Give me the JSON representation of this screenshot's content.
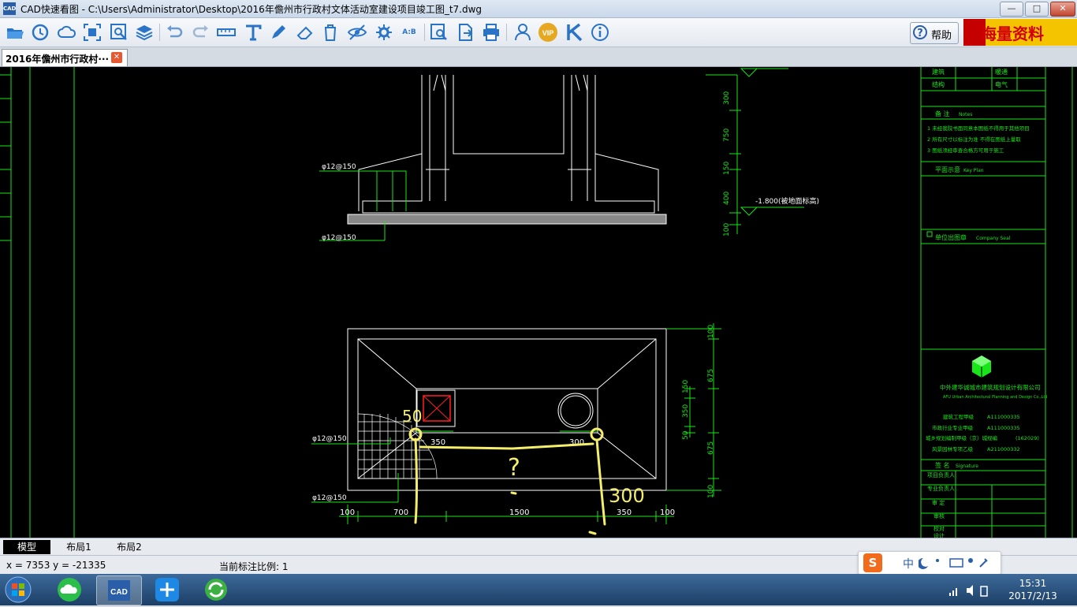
{
  "window": {
    "app_icon_text": "CAD",
    "title": "CAD快速看图 - C:\\Users\\Administrator\\Desktop\\2016年儋州市行政村文体活动室建设项目竣工图_t7.dwg",
    "controls": {
      "minimize": "—",
      "maximize": "□",
      "close": "✕"
    }
  },
  "toolbar": {
    "tools": [
      "open-folder-icon",
      "history-icon",
      "cloud-icon",
      "fit-extents-icon",
      "zoom-window-icon",
      "layers-icon",
      "undo-icon",
      "redo-icon",
      "measure-icon",
      "text-icon",
      "pen-icon",
      "eraser-icon",
      "delete-icon",
      "hide-icon",
      "settings-icon",
      "ab-dimension-icon",
      "find-text-icon",
      "export-icon",
      "print-icon",
      "user-icon",
      "vip-icon",
      "k-icon",
      "info-icon"
    ],
    "vip_label": "VIP",
    "ab_label": "A:B",
    "help_label": "帮助",
    "banner_text": "海量资料"
  },
  "doc_tab": {
    "label": "2016年儋州市行政村···",
    "close": "✕"
  },
  "drawing": {
    "section_labels": {
      "rebar_top_left": "φ12@150",
      "rebar_bottom_left": "φ12@150",
      "elevation": "-1.800(被地面标高)"
    },
    "section_dims": [
      "300",
      "750",
      "150",
      "400",
      "100"
    ],
    "plan_labels": {
      "rebar_mid": "φ12@150",
      "rebar_low": "φ12@150"
    },
    "plan_inner_dims": [
      "350",
      "300"
    ],
    "plan_right_dims": [
      "100",
      "675",
      "150",
      "350",
      "50",
      "675",
      "100"
    ],
    "plan_bottom_dims": [
      "100",
      "700",
      "1500",
      "350",
      "100"
    ],
    "markup": {
      "left_note": "50",
      "question": "?",
      "right_note": "300"
    },
    "title_block": {
      "rows_top": [
        "建筑",
        "暖通",
        "结构",
        "电气"
      ],
      "notes_header": "备 注",
      "notes_header_en": "Notes",
      "notes": [
        "1 未经我院书面同意本图纸不得用于其他项目",
        "2 所有尺寸以标注为准 不得在图纸上量取",
        "3 图纸须经审查合格方可用于施工"
      ],
      "key_plan": "平面示意",
      "key_plan_en": "Key Plan",
      "stamp": "单位出图章",
      "stamp_en": "Company Seal",
      "company": "中外建华诚城市建筑规划设计有限公司",
      "company_en": "AFU Urban Architectural Planning and Design Co.,Ltd",
      "cert_lines": [
        "建筑工程甲级",
        "A111000335",
        "市政行业专业甲级",
        "A111000335",
        "城乡规划编制甲级（京）城规编",
        "(162029)",
        "风景园林专项乙级",
        "A211000332"
      ],
      "sign_header": "签 名",
      "sign_header_en": "Signature",
      "sign_rows": [
        "项目负责人",
        "专业负责人",
        "审 定",
        "审核",
        "校对",
        "设计"
      ]
    }
  },
  "layout_tabs": [
    {
      "label": "模型",
      "active": true
    },
    {
      "label": "布局1",
      "active": false
    },
    {
      "label": "布局2",
      "active": false
    }
  ],
  "status": {
    "coords": "x = 7353  y = -21335",
    "scale": "当前标注比例: 1"
  },
  "ime": {
    "logo": "S",
    "mode": "中"
  },
  "clock": {
    "time": "15:31",
    "date": "2017/2/13"
  },
  "colors": {
    "cad_bg": "#000000",
    "cad_green": "#19e619",
    "cad_white": "#ffffff",
    "cad_red": "#ff2020",
    "markup_yellow": "#f5ee6a",
    "accent": "#2a5ea8"
  }
}
